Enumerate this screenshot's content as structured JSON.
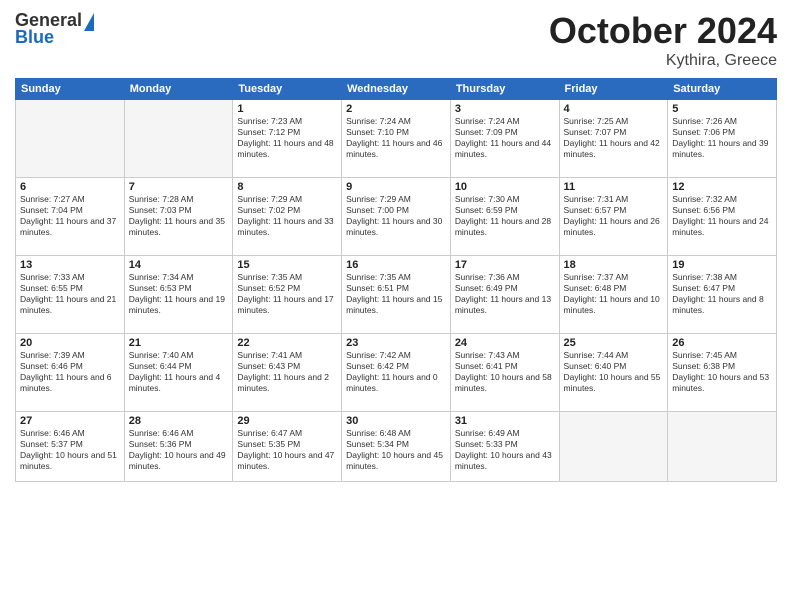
{
  "logo": {
    "general": "General",
    "blue": "Blue"
  },
  "header": {
    "month": "October 2024",
    "location": "Kythira, Greece"
  },
  "weekdays": [
    "Sunday",
    "Monday",
    "Tuesday",
    "Wednesday",
    "Thursday",
    "Friday",
    "Saturday"
  ],
  "weeks": [
    [
      {
        "day": "",
        "empty": true
      },
      {
        "day": "",
        "empty": true
      },
      {
        "day": "1",
        "sunrise": "Sunrise: 7:23 AM",
        "sunset": "Sunset: 7:12 PM",
        "daylight": "Daylight: 11 hours and 48 minutes."
      },
      {
        "day": "2",
        "sunrise": "Sunrise: 7:24 AM",
        "sunset": "Sunset: 7:10 PM",
        "daylight": "Daylight: 11 hours and 46 minutes."
      },
      {
        "day": "3",
        "sunrise": "Sunrise: 7:24 AM",
        "sunset": "Sunset: 7:09 PM",
        "daylight": "Daylight: 11 hours and 44 minutes."
      },
      {
        "day": "4",
        "sunrise": "Sunrise: 7:25 AM",
        "sunset": "Sunset: 7:07 PM",
        "daylight": "Daylight: 11 hours and 42 minutes."
      },
      {
        "day": "5",
        "sunrise": "Sunrise: 7:26 AM",
        "sunset": "Sunset: 7:06 PM",
        "daylight": "Daylight: 11 hours and 39 minutes."
      }
    ],
    [
      {
        "day": "6",
        "sunrise": "Sunrise: 7:27 AM",
        "sunset": "Sunset: 7:04 PM",
        "daylight": "Daylight: 11 hours and 37 minutes."
      },
      {
        "day": "7",
        "sunrise": "Sunrise: 7:28 AM",
        "sunset": "Sunset: 7:03 PM",
        "daylight": "Daylight: 11 hours and 35 minutes."
      },
      {
        "day": "8",
        "sunrise": "Sunrise: 7:29 AM",
        "sunset": "Sunset: 7:02 PM",
        "daylight": "Daylight: 11 hours and 33 minutes."
      },
      {
        "day": "9",
        "sunrise": "Sunrise: 7:29 AM",
        "sunset": "Sunset: 7:00 PM",
        "daylight": "Daylight: 11 hours and 30 minutes."
      },
      {
        "day": "10",
        "sunrise": "Sunrise: 7:30 AM",
        "sunset": "Sunset: 6:59 PM",
        "daylight": "Daylight: 11 hours and 28 minutes."
      },
      {
        "day": "11",
        "sunrise": "Sunrise: 7:31 AM",
        "sunset": "Sunset: 6:57 PM",
        "daylight": "Daylight: 11 hours and 26 minutes."
      },
      {
        "day": "12",
        "sunrise": "Sunrise: 7:32 AM",
        "sunset": "Sunset: 6:56 PM",
        "daylight": "Daylight: 11 hours and 24 minutes."
      }
    ],
    [
      {
        "day": "13",
        "sunrise": "Sunrise: 7:33 AM",
        "sunset": "Sunset: 6:55 PM",
        "daylight": "Daylight: 11 hours and 21 minutes."
      },
      {
        "day": "14",
        "sunrise": "Sunrise: 7:34 AM",
        "sunset": "Sunset: 6:53 PM",
        "daylight": "Daylight: 11 hours and 19 minutes."
      },
      {
        "day": "15",
        "sunrise": "Sunrise: 7:35 AM",
        "sunset": "Sunset: 6:52 PM",
        "daylight": "Daylight: 11 hours and 17 minutes."
      },
      {
        "day": "16",
        "sunrise": "Sunrise: 7:35 AM",
        "sunset": "Sunset: 6:51 PM",
        "daylight": "Daylight: 11 hours and 15 minutes."
      },
      {
        "day": "17",
        "sunrise": "Sunrise: 7:36 AM",
        "sunset": "Sunset: 6:49 PM",
        "daylight": "Daylight: 11 hours and 13 minutes."
      },
      {
        "day": "18",
        "sunrise": "Sunrise: 7:37 AM",
        "sunset": "Sunset: 6:48 PM",
        "daylight": "Daylight: 11 hours and 10 minutes."
      },
      {
        "day": "19",
        "sunrise": "Sunrise: 7:38 AM",
        "sunset": "Sunset: 6:47 PM",
        "daylight": "Daylight: 11 hours and 8 minutes."
      }
    ],
    [
      {
        "day": "20",
        "sunrise": "Sunrise: 7:39 AM",
        "sunset": "Sunset: 6:46 PM",
        "daylight": "Daylight: 11 hours and 6 minutes."
      },
      {
        "day": "21",
        "sunrise": "Sunrise: 7:40 AM",
        "sunset": "Sunset: 6:44 PM",
        "daylight": "Daylight: 11 hours and 4 minutes."
      },
      {
        "day": "22",
        "sunrise": "Sunrise: 7:41 AM",
        "sunset": "Sunset: 6:43 PM",
        "daylight": "Daylight: 11 hours and 2 minutes."
      },
      {
        "day": "23",
        "sunrise": "Sunrise: 7:42 AM",
        "sunset": "Sunset: 6:42 PM",
        "daylight": "Daylight: 11 hours and 0 minutes."
      },
      {
        "day": "24",
        "sunrise": "Sunrise: 7:43 AM",
        "sunset": "Sunset: 6:41 PM",
        "daylight": "Daylight: 10 hours and 58 minutes."
      },
      {
        "day": "25",
        "sunrise": "Sunrise: 7:44 AM",
        "sunset": "Sunset: 6:40 PM",
        "daylight": "Daylight: 10 hours and 55 minutes."
      },
      {
        "day": "26",
        "sunrise": "Sunrise: 7:45 AM",
        "sunset": "Sunset: 6:38 PM",
        "daylight": "Daylight: 10 hours and 53 minutes."
      }
    ],
    [
      {
        "day": "27",
        "sunrise": "Sunrise: 6:46 AM",
        "sunset": "Sunset: 5:37 PM",
        "daylight": "Daylight: 10 hours and 51 minutes."
      },
      {
        "day": "28",
        "sunrise": "Sunrise: 6:46 AM",
        "sunset": "Sunset: 5:36 PM",
        "daylight": "Daylight: 10 hours and 49 minutes."
      },
      {
        "day": "29",
        "sunrise": "Sunrise: 6:47 AM",
        "sunset": "Sunset: 5:35 PM",
        "daylight": "Daylight: 10 hours and 47 minutes."
      },
      {
        "day": "30",
        "sunrise": "Sunrise: 6:48 AM",
        "sunset": "Sunset: 5:34 PM",
        "daylight": "Daylight: 10 hours and 45 minutes."
      },
      {
        "day": "31",
        "sunrise": "Sunrise: 6:49 AM",
        "sunset": "Sunset: 5:33 PM",
        "daylight": "Daylight: 10 hours and 43 minutes."
      },
      {
        "day": "",
        "empty": true
      },
      {
        "day": "",
        "empty": true
      }
    ]
  ]
}
